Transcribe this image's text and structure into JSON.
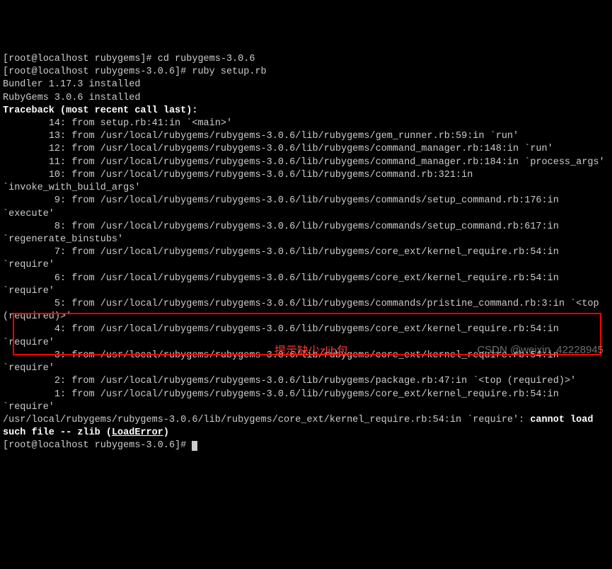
{
  "lines": [
    {
      "t": "[root@localhost rubygems]# cd rubygems-3.0.6"
    },
    {
      "t": "[root@localhost rubygems-3.0.6]# ruby setup.rb"
    },
    {
      "t": "Bundler 1.17.3 installed"
    },
    {
      "t": "RubyGems 3.0.6 installed"
    },
    {
      "t": "Traceback (most recent call last):",
      "bold": true
    },
    {
      "t": "        14: from setup.rb:41:in `<main>'"
    },
    {
      "t": "        13: from /usr/local/rubygems/rubygems-3.0.6/lib/rubygems/gem_runner.rb:59:in `run'"
    },
    {
      "t": "        12: from /usr/local/rubygems/rubygems-3.0.6/lib/rubygems/command_manager.rb:148:in `run'"
    },
    {
      "t": "        11: from /usr/local/rubygems/rubygems-3.0.6/lib/rubygems/command_manager.rb:184:in `process_args'"
    },
    {
      "t": "        10: from /usr/local/rubygems/rubygems-3.0.6/lib/rubygems/command.rb:321:in `invoke_with_build_args'"
    },
    {
      "t": "         9: from /usr/local/rubygems/rubygems-3.0.6/lib/rubygems/commands/setup_command.rb:176:in `execute'"
    },
    {
      "t": "         8: from /usr/local/rubygems/rubygems-3.0.6/lib/rubygems/commands/setup_command.rb:617:in `regenerate_binstubs'"
    },
    {
      "t": "         7: from /usr/local/rubygems/rubygems-3.0.6/lib/rubygems/core_ext/kernel_require.rb:54:in `require'"
    },
    {
      "t": "         6: from /usr/local/rubygems/rubygems-3.0.6/lib/rubygems/core_ext/kernel_require.rb:54:in `require'"
    },
    {
      "t": "         5: from /usr/local/rubygems/rubygems-3.0.6/lib/rubygems/commands/pristine_command.rb:3:in `<top (required)>'"
    },
    {
      "t": "         4: from /usr/local/rubygems/rubygems-3.0.6/lib/rubygems/core_ext/kernel_require.rb:54:in `require'"
    },
    {
      "t": "         3: from /usr/local/rubygems/rubygems-3.0.6/lib/rubygems/core_ext/kernel_require.rb:54:in `require'"
    },
    {
      "t": "         2: from /usr/local/rubygems/rubygems-3.0.6/lib/rubygems/package.rb:47:in `<top (required)>'"
    },
    {
      "t": "         1: from /usr/local/rubygems/rubygems-3.0.6/lib/rubygems/core_ext/kernel_require.rb:54:in `require'"
    }
  ],
  "error": {
    "prefix": "/usr/local/rubygems/rubygems-3.0.6/lib/rubygems/core_ext/kernel_require.rb:54:in `require': ",
    "msg": "cannot load such file -- zlib (",
    "cls": "LoadError",
    "suffix": ")"
  },
  "prompt": "[root@localhost rubygems-3.0.6]# ",
  "annotation": "提示缺少zlib包",
  "watermark": "CSDN @weixin_42228945"
}
